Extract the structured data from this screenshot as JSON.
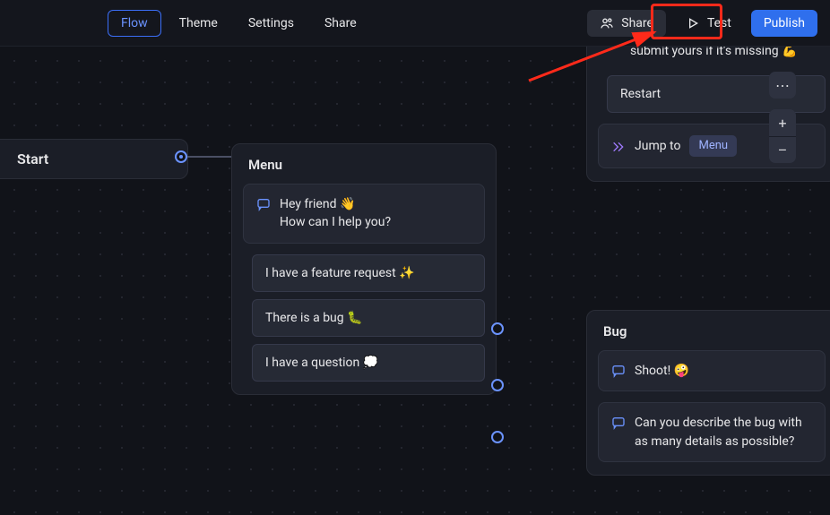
{
  "header": {
    "tabs": [
      "Flow",
      "Theme",
      "Settings",
      "Share"
    ],
    "active_tab": "Flow",
    "share_label": "Share",
    "test_label": "Test",
    "publish_label": "Publish"
  },
  "annotation": {
    "highlight_target": "test-button"
  },
  "float": {
    "more": "⋯",
    "zoom_in": "+",
    "zoom_out": "–"
  },
  "nodes": {
    "start": {
      "title": "Start"
    },
    "menu": {
      "title": "Menu",
      "message": "Hey friend 👋\nHow can I help you?",
      "choices": [
        "I have a feature request ✨",
        "There is a bug 🐛",
        "I have a question 💭"
      ]
    },
    "feature": {
      "message_tail": "existing feature requests and submit yours if it's missing 💪",
      "choice": "Restart",
      "jump_label": "Jump to",
      "jump_target": "Menu"
    },
    "bug": {
      "title": "Bug",
      "message1": "Shoot! 🤪",
      "message2": "Can you describe the bug with as many details as possible?"
    }
  }
}
